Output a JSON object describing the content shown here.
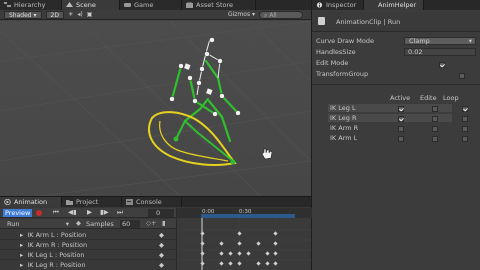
{
  "scene_panel": {
    "tabs": [
      {
        "label": "Hierarchy",
        "icon": "hierarchy-icon"
      },
      {
        "label": "Scene",
        "icon": "scene-icon"
      },
      {
        "label": "Game",
        "icon": "game-icon"
      },
      {
        "label": "Asset Store",
        "icon": "asset-store-icon"
      }
    ],
    "shading_mode": "Shaded",
    "view_2d_label": "2D",
    "gizmos_label": "Gizmos",
    "search_placeholder": "All"
  },
  "inspector_panel": {
    "tabs": [
      {
        "label": "Inspector",
        "icon": "info-icon"
      },
      {
        "label": "AnimHelper",
        "icon": "anim-helper-icon"
      }
    ],
    "object_name": "AnimationClip | Run",
    "fields": [
      {
        "label": "Curve Draw Mode",
        "value": "Clamp",
        "type": "dropdown"
      },
      {
        "label": "HandlesSize",
        "value": "0.02",
        "type": "number"
      },
      {
        "label": "Edit Mode",
        "checked": true,
        "type": "checkbox"
      },
      {
        "label": "TransformGroup",
        "checked": false,
        "type": "checkbox"
      }
    ],
    "ik_table": {
      "columns": [
        "Active",
        "Edite",
        "Loop"
      ],
      "rows": [
        {
          "label": "IK Leg L",
          "active": true,
          "edite": false,
          "loop": true
        },
        {
          "label": "IK Leg R",
          "active": true,
          "edite": false,
          "loop": false
        },
        {
          "label": "IK Arm R",
          "active": false,
          "edite": false,
          "loop": false
        },
        {
          "label": "IK Arm L",
          "active": false,
          "edite": false,
          "loop": false
        }
      ]
    }
  },
  "animation_panel": {
    "tabs": [
      {
        "label": "Animation",
        "icon": "animation-icon"
      },
      {
        "label": "Project",
        "icon": "project-icon"
      },
      {
        "label": "Console",
        "icon": "console-icon"
      }
    ],
    "preview_label": "Preview",
    "frame_value": "0",
    "clip_name": "Run",
    "samples_label": "Samples",
    "samples_value": "60",
    "timeline_ticks": [
      "0:00",
      "0:30"
    ],
    "tracks": [
      "IK Arm L : Position",
      "IK Arm R : Position",
      "IK Leg L : Position",
      "IK Leg R : Position"
    ]
  },
  "colors": {
    "accent_blue": "#3d7bd6",
    "selection_green": "#2fbf2f",
    "curve_yellow": "#e6d21e",
    "record_red": "#c42b2b"
  }
}
